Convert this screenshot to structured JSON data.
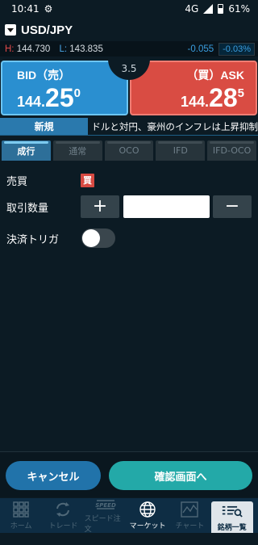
{
  "status": {
    "time": "10:41",
    "network": "4G",
    "battery": "61%"
  },
  "pair": {
    "name": "USD/JPY"
  },
  "range": {
    "high_label": "H:",
    "high": "144.730",
    "low_label": "L:",
    "low": "143.835",
    "change": "-0.055",
    "change_pct": "-0.03%"
  },
  "quote": {
    "spread": "3.5",
    "bid": {
      "label": "BID（売）",
      "price_main": "144.",
      "price_big": "25",
      "price_sup": "0"
    },
    "ask": {
      "label": "（買）ASK",
      "price_main": "144.",
      "price_big": "28",
      "price_sup": "5"
    }
  },
  "news": {
    "tag": "新規",
    "ticker": "ドルと対円、豪州のインフレは上昇抑制"
  },
  "order_types": [
    "成行",
    "通常",
    "OCO",
    "IFD",
    "IFD-OCO"
  ],
  "active_order_type": "成行",
  "form": {
    "side_label": "売買",
    "side_value": "買",
    "qty_label": "取引数量",
    "qty_plus": "+",
    "qty_minus": "−",
    "qty_value": "",
    "trigger_label": "決済トリガ",
    "trigger_on": false
  },
  "actions": {
    "cancel": "キャンセル",
    "confirm": "確認画面へ"
  },
  "nav": [
    {
      "label": "ホーム",
      "icon": "home-grid-icon"
    },
    {
      "label": "トレード",
      "icon": "refresh-arrows-icon"
    },
    {
      "label": "スピード注文",
      "icon": "speed-icon"
    },
    {
      "label": "マーケット",
      "icon": "globe-icon"
    },
    {
      "label": "チャート",
      "icon": "chart-icon"
    },
    {
      "label": "銘柄一覧",
      "icon": "list-search-icon"
    }
  ],
  "colors": {
    "bid": "#2a8fd0",
    "ask": "#d94c43",
    "accent": "#23a9a8",
    "nav_bg": "#0e2d44"
  }
}
